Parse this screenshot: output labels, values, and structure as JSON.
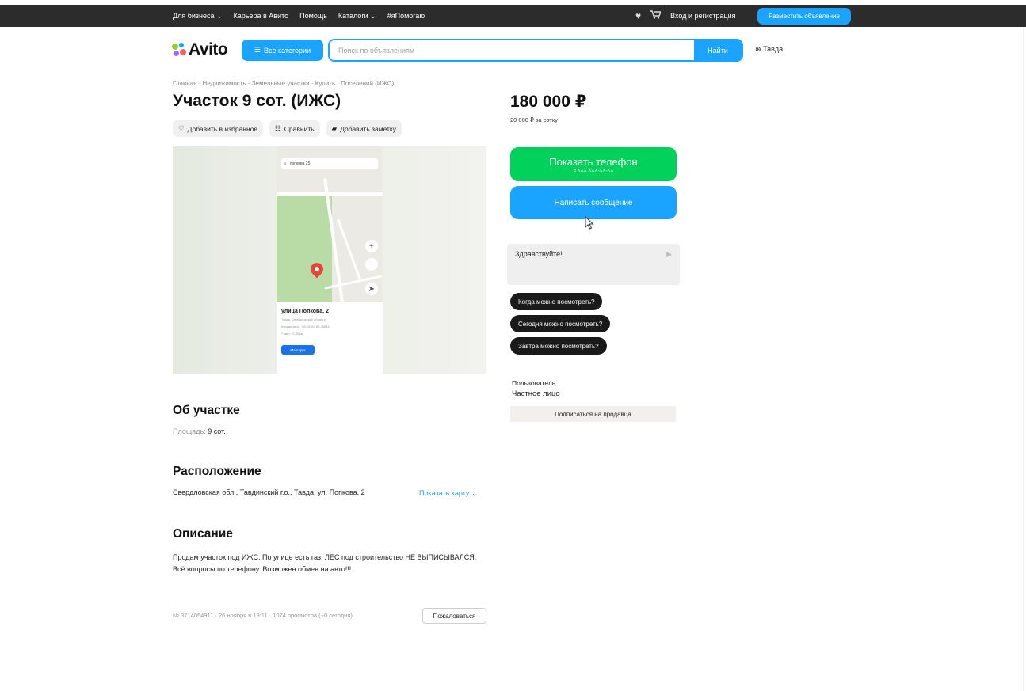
{
  "topbar": {
    "nav": [
      "Для бизнеса ⌄",
      "Карьера в Авито",
      "Помощь",
      "Каталоги ⌄",
      "#яПомогаю"
    ],
    "login": "Вход и регистрация",
    "post_ad": "Разместить объявление"
  },
  "header": {
    "logo": "Avito",
    "categories": "Все категории",
    "search_placeholder": "Поиск по объявлениям",
    "search_button": "Найти",
    "location": "Тавда"
  },
  "listing": {
    "breadcrumb": "Главная · Недвижимость · Земельные участки · Купить · Поселений (ИЖС)",
    "title": "Участок 9 сот. (ИЖС)",
    "actions": {
      "favorite": "Добавить в избранное",
      "compare": "Сравнить",
      "note": "Добавить заметку"
    },
    "map_preview": {
      "search_text": "попкова 25",
      "address": "улица Попкова, 2",
      "region": "Тавда, Свердловская область",
      "coords": "Координаты · 58.03467 65.28654",
      "distance": "7 мин · 2,39 км",
      "route": "Маршрут"
    },
    "about": {
      "heading": "Об участке",
      "area_label": "Площадь:",
      "area_value": "9 сот."
    },
    "location": {
      "heading": "Расположение",
      "address": "Свердловская обл., Тавдинский г.о., Тавда, ул. Попкова, 2",
      "show_map": "Показать карту ⌄"
    },
    "description": {
      "heading": "Описание",
      "text": "Продам участок под ИЖС. По улице есть газ. ЛЕС под строительство НЕ ВЫПИСЫВАЛСЯ. Всё вопросы по телефону. Возможен обмен на авто!!!"
    },
    "meta": "№ 3714054911 · 26 ноября в 19:11 · 1074 просмотра (+0 сегодня)",
    "report": "Пожаловаться"
  },
  "sidebar": {
    "price": "180 000 ₽",
    "price_per": "20 000 ₽ за сотку",
    "show_phone": "Показать телефон",
    "phone_mask": "8 XXX XXX-XX-XX",
    "write_message": "Написать сообщение",
    "chat_text": "Здравствуйте!",
    "quick_replies": [
      "Когда можно посмотреть?",
      "Сегодня можно посмотреть?",
      "Завтра можно посмотреть?"
    ],
    "seller_role": "Пользователь",
    "seller_type": "Частное лицо",
    "subscribe": "Подписаться на продавца"
  },
  "colors": {
    "accent": "#1aa3ff",
    "green": "#02d15c",
    "topbar": "#2c2c2c",
    "logo_dots": [
      "#97cf26",
      "#0af",
      "#ff6163",
      "#a169f7"
    ]
  },
  "icons": [
    "heart-icon",
    "cart-icon",
    "search-icon",
    "compare-icon",
    "note-icon",
    "location-icon",
    "map-pin-icon",
    "send-icon",
    "cursor-icon"
  ]
}
